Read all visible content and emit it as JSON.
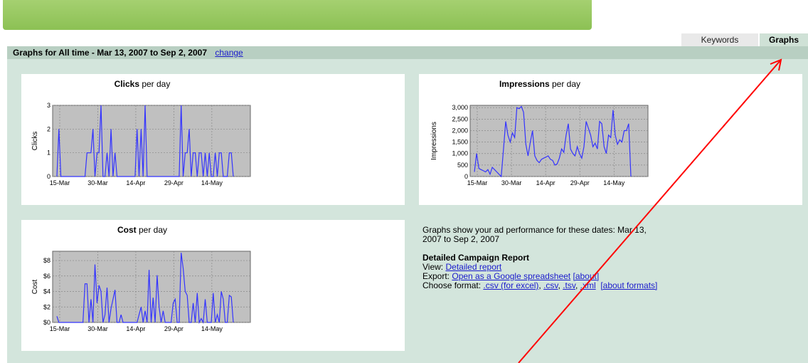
{
  "tabs": {
    "keywords": "Keywords",
    "graphs": "Graphs"
  },
  "header": {
    "title": "Graphs for All time - Mar 13, 2007 to Sep 2, 2007",
    "change_link": "change"
  },
  "charts": {
    "clicks": {
      "title_bold": "Clicks",
      "title_rest": " per day"
    },
    "impressions": {
      "title_bold": "Impressions",
      "title_rest": " per day"
    },
    "cost": {
      "title_bold": "Cost",
      "title_rest": " per day"
    }
  },
  "info": {
    "description": "Graphs show your ad performance for these dates: Mar 13, 2007 to Sep 2, 2007",
    "report_title": "Detailed Campaign Report",
    "view_label": "View:",
    "view_link": "Detailed report",
    "export_label": "Export:",
    "export_link": "Open as a Google spreadsheet",
    "export_about": "[about]",
    "format_label": "Choose format:",
    "format_csv_excel": ".csv (for excel)",
    "format_csv": ".csv",
    "format_tsv": ".tsv",
    "format_xml": ".xml",
    "format_about": "[about formats]"
  },
  "colors": {
    "banner": "#8cc154",
    "panel": "#d3e5dc",
    "header_bar": "#b8cfc2",
    "series": "#3333ff",
    "plot_bg": "#c0c0c0",
    "annotation_arrow": "#ff0000"
  },
  "chart_data": [
    {
      "type": "line",
      "ylabel": "Clicks",
      "xticks": [
        "15-Mar",
        "30-Mar",
        "14-Apr",
        "29-Apr",
        "14-May"
      ],
      "yticks": [
        "0",
        "1",
        "2",
        "3"
      ],
      "ylim": [
        0,
        3
      ],
      "x_start_day": 0,
      "values": [
        0,
        2,
        0,
        0,
        0,
        0,
        0,
        0,
        0,
        0,
        0,
        0,
        0,
        0,
        0,
        1,
        1,
        1,
        2,
        0,
        1,
        1,
        3,
        0,
        0,
        1,
        0,
        2,
        0,
        1,
        0,
        0,
        0,
        0,
        0,
        0,
        0,
        0,
        0,
        0,
        2,
        0,
        2,
        0,
        3,
        0,
        0,
        0,
        0,
        0,
        0,
        0,
        0,
        0,
        0,
        0,
        0,
        0,
        0,
        0,
        0,
        0,
        3,
        0,
        1,
        1,
        2,
        0,
        1,
        1,
        0,
        1,
        1,
        0,
        1,
        0,
        1,
        0,
        0,
        1,
        0,
        1,
        1,
        0,
        0,
        0,
        1,
        1,
        0
      ],
      "grid": true
    },
    {
      "type": "line",
      "ylabel": "Impressions",
      "xticks": [
        "15-Mar",
        "30-Mar",
        "14-Apr",
        "29-Apr",
        "14-May"
      ],
      "yticks": [
        "0",
        "500",
        "1,000",
        "1,500",
        "2,000",
        "2,500",
        "3,000"
      ],
      "ylim": [
        0,
        3100
      ],
      "values": [
        200,
        1000,
        350,
        300,
        250,
        200,
        300,
        100,
        400,
        300,
        200,
        100,
        0,
        1200,
        2400,
        1800,
        1500,
        1900,
        1700,
        3000,
        2950,
        3050,
        2800,
        1400,
        900,
        1500,
        2000,
        900,
        700,
        600,
        750,
        800,
        850,
        900,
        750,
        700,
        500,
        550,
        800,
        1200,
        1050,
        1800,
        2300,
        1200,
        1000,
        900,
        1300,
        1000,
        800,
        1300,
        2400,
        2100,
        1800,
        1300,
        1450,
        1200,
        2400,
        2300,
        1300,
        1000,
        1800,
        1700,
        2900,
        1800,
        1400,
        1600,
        1500,
        2000,
        2000,
        2300,
        0
      ],
      "grid": true
    },
    {
      "type": "line",
      "ylabel": "Cost",
      "xticks": [
        "15-Mar",
        "30-Mar",
        "14-Apr",
        "29-Apr",
        "14-May"
      ],
      "yticks": [
        "$0",
        "$2",
        "$4",
        "$6",
        "$8"
      ],
      "ylim": [
        0,
        9.2
      ],
      "values": [
        0.8,
        0,
        0,
        0,
        0,
        0,
        0,
        0,
        0,
        0,
        0,
        0,
        0,
        0,
        5,
        5,
        0,
        3,
        0,
        7.5,
        2.5,
        4.8,
        4,
        0,
        1,
        4.5,
        0,
        1.8,
        3,
        4.2,
        0,
        0,
        1,
        0,
        0,
        0,
        0,
        0,
        0,
        0,
        0,
        1,
        2,
        0,
        1.5,
        0,
        6.8,
        0,
        3.2,
        0,
        6.1,
        2,
        0,
        1.5,
        0,
        0,
        0,
        0,
        2.5,
        3,
        0,
        0,
        9,
        7,
        4,
        3.5,
        0,
        0,
        2.5,
        0,
        3.8,
        0,
        0.5,
        0,
        3,
        0,
        0,
        0,
        3.8,
        0,
        1,
        0,
        4,
        3,
        0,
        0,
        3.5,
        3.3,
        0
      ]
    }
  ]
}
